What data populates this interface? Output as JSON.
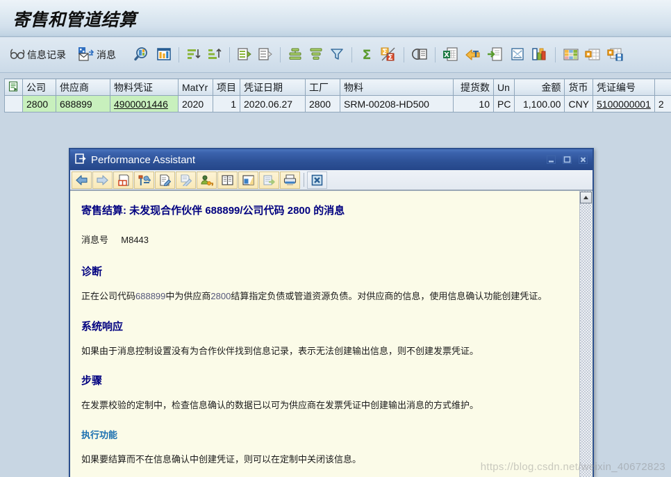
{
  "app": {
    "title": "寄售和管道结算"
  },
  "toolbar": {
    "buttons": [
      {
        "name": "info-record-button",
        "label": "信息记录",
        "icon": "glasses-icon"
      },
      {
        "name": "messages-button",
        "label": "消息",
        "icon": "envelope-message-icon"
      },
      {
        "name": "find-button",
        "label": "",
        "icon": "magnifier-icon"
      },
      {
        "name": "detail-button",
        "label": "",
        "icon": "column-chart-icon"
      },
      {
        "name": "sort-ascending-button",
        "label": "",
        "icon": "sort-ascending-icon"
      },
      {
        "name": "sort-descending-button",
        "label": "",
        "icon": "sort-descending-icon"
      },
      {
        "name": "sort-up-button",
        "label": "",
        "icon": "sort-up-icon"
      },
      {
        "name": "sort-down-button",
        "label": "",
        "icon": "sort-down-icon"
      },
      {
        "name": "filter-button",
        "label": "",
        "icon": "filter-funnel-icon"
      },
      {
        "name": "total-button",
        "label": "",
        "icon": "sigma-icon"
      },
      {
        "name": "subtotal-button",
        "label": "",
        "icon": "sigma-percent-icon"
      },
      {
        "name": "print-preview-button",
        "label": "",
        "icon": "print-preview-icon"
      },
      {
        "name": "export-excel-button",
        "label": "",
        "icon": "excel-export-icon"
      },
      {
        "name": "export-word-button",
        "label": "",
        "icon": "word-export-icon"
      },
      {
        "name": "export-local-button",
        "label": "",
        "icon": "export-file-icon"
      },
      {
        "name": "mail-recipient-button",
        "label": "",
        "icon": "send-mail-icon"
      },
      {
        "name": "graphic-button",
        "label": "",
        "icon": "bar-graphic-icon"
      },
      {
        "name": "layout-select-button",
        "label": "",
        "icon": "grid-layout-icon"
      },
      {
        "name": "layout-change-button",
        "label": "",
        "icon": "grid-change-icon"
      },
      {
        "name": "layout-save-button",
        "label": "",
        "icon": "grid-save-icon"
      }
    ]
  },
  "grid": {
    "columns": [
      {
        "key": "company",
        "label": "公司",
        "align": "left"
      },
      {
        "key": "vendor",
        "label": "供应商",
        "align": "left"
      },
      {
        "key": "matdoc",
        "label": "物料凭证",
        "align": "left"
      },
      {
        "key": "matyr",
        "label": "MatYr",
        "align": "left"
      },
      {
        "key": "item",
        "label": "项目",
        "align": "right"
      },
      {
        "key": "docdate",
        "label": "凭证日期",
        "align": "left"
      },
      {
        "key": "plant",
        "label": "工厂",
        "align": "left"
      },
      {
        "key": "material",
        "label": "物料",
        "align": "left"
      },
      {
        "key": "qty",
        "label": "提货数",
        "align": "right"
      },
      {
        "key": "unit",
        "label": "Un",
        "align": "left"
      },
      {
        "key": "amount",
        "label": "金额",
        "align": "right"
      },
      {
        "key": "currency",
        "label": "货币",
        "align": "left"
      },
      {
        "key": "docno",
        "label": "凭证编号",
        "align": "left"
      },
      {
        "key": "extra",
        "label": "",
        "align": "left"
      }
    ],
    "rows": [
      {
        "company": "2800",
        "vendor": "688899",
        "matdoc": "4900001446",
        "matyr": "2020",
        "item": "1",
        "docdate": "2020.06.27",
        "plant": "2800",
        "material": "SRM-00208-HD500",
        "qty": "10",
        "unit": "PC",
        "amount": "1,100.00",
        "currency": "CNY",
        "docno": "5100000001",
        "extra": "2"
      }
    ]
  },
  "dialog": {
    "title": "Performance Assistant",
    "window_buttons": [
      {
        "name": "minimize-button",
        "icon": "minimize-icon"
      },
      {
        "name": "maximize-button",
        "icon": "maximize-icon"
      },
      {
        "name": "close-button",
        "icon": "close-icon"
      }
    ],
    "toolbar": [
      {
        "name": "back-button",
        "icon": "arrow-left-icon"
      },
      {
        "name": "forward-button",
        "icon": "arrow-right-icon"
      },
      {
        "name": "glossary-button",
        "icon": "book-glossary-icon"
      },
      {
        "name": "technical-info-button",
        "icon": "hammer-wrench-icon"
      },
      {
        "name": "note-button",
        "icon": "note-pencil-icon"
      },
      {
        "name": "create-note-button",
        "icon": "pencil-note-icon"
      },
      {
        "name": "support-button",
        "icon": "person-key-icon"
      },
      {
        "name": "application-help-button",
        "icon": "open-book-icon"
      },
      {
        "name": "customize-button",
        "icon": "window-layout-icon"
      },
      {
        "name": "export-button",
        "icon": "export-arrow-icon"
      },
      {
        "name": "print-button",
        "icon": "printer-icon"
      },
      {
        "name": "close-assistant-button",
        "icon": "close-box-icon"
      }
    ],
    "message": {
      "title": "寄售结算: 未发现合作伙伴  688899/公司代码  2800 的消息",
      "message_no_label": "消息号",
      "message_no": "M8443",
      "sections": [
        {
          "name": "diagnosis",
          "heading": "诊断",
          "style": "normal",
          "body_parts": [
            {
              "text": "正在公司代码",
              "dim": false
            },
            {
              "text": "688899",
              "dim": true
            },
            {
              "text": "中为供应商",
              "dim": false
            },
            {
              "text": "2800",
              "dim": true
            },
            {
              "text": "结算指定负债或管道资源负债。对供应商的信息，使用信息确认功能创建凭证。",
              "dim": false
            }
          ]
        },
        {
          "name": "system-response",
          "heading": "系统响应",
          "style": "normal",
          "body_parts": [
            {
              "text": "如果由于消息控制设置没有为合作伙伴找到信息记录，表示无法创建输出信息，则不创建发票凭证。",
              "dim": false
            }
          ]
        },
        {
          "name": "procedure",
          "heading": "步骤",
          "style": "normal",
          "body_parts": [
            {
              "text": "在发票校验的定制中，检查信息确认的数据已以可为供应商在发票凭证中创建输出消息的方式维护。",
              "dim": false
            }
          ]
        },
        {
          "name": "execute-function",
          "heading": "执行功能",
          "style": "link",
          "body_parts": [
            {
              "text": "如果要结算而不在信息确认中创建凭证，则可以在定制中关闭该信息。",
              "dim": false
            }
          ]
        }
      ]
    },
    "scrollbar": {
      "name": "vertical-scrollbar",
      "up_button": "scroll-up-button"
    }
  },
  "watermark": {
    "text": "https://blog.csdn.net/weixin_40672823"
  },
  "colors": {
    "banner_top": "#edf3f8",
    "banner_bottom": "#bfd2e2",
    "dialog_title": "#2d5196",
    "message_heading": "#000080",
    "link_heading": "#1a6fb0",
    "highlight_cell": "#c8f0bd",
    "content_bg": "#fbfbe8"
  }
}
